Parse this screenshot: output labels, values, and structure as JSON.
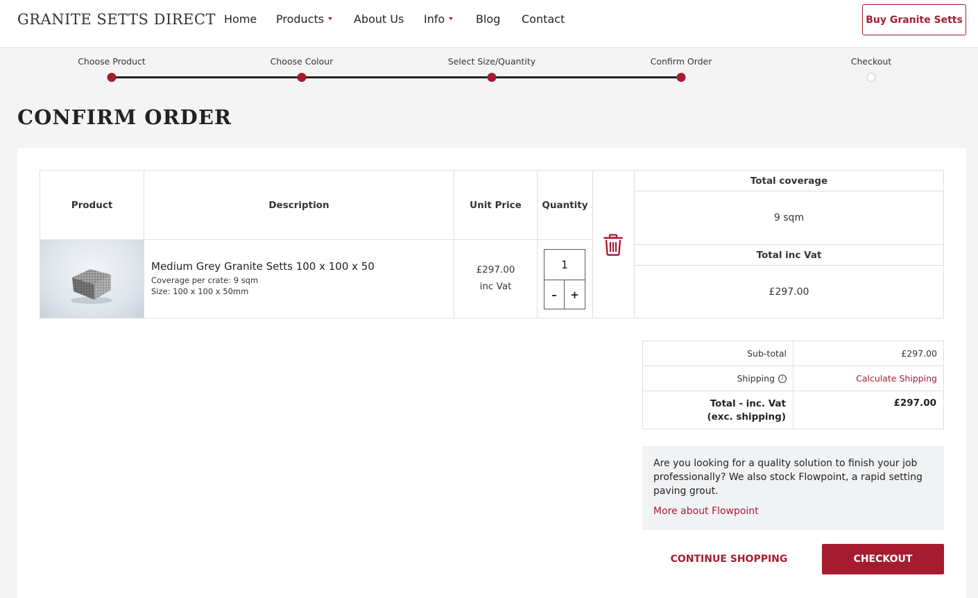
{
  "brand": {
    "logo_text": "GRANITE SETTS DIRECT",
    "accent": "#a51c30"
  },
  "nav": {
    "items": [
      {
        "label": "Home",
        "dropdown": false
      },
      {
        "label": "Products",
        "dropdown": true
      },
      {
        "label": "About Us",
        "dropdown": false
      },
      {
        "label": "Info",
        "dropdown": true
      },
      {
        "label": "Blog",
        "dropdown": false
      },
      {
        "label": "Contact",
        "dropdown": false
      }
    ],
    "cta_label": "Buy Granite Setts"
  },
  "progress": {
    "steps": [
      {
        "label": "Choose Product",
        "done": true
      },
      {
        "label": "Choose Colour",
        "done": true
      },
      {
        "label": "Select Size/Quantity",
        "done": true
      },
      {
        "label": "Confirm Order",
        "done": true
      },
      {
        "label": "Checkout",
        "done": false
      }
    ]
  },
  "page": {
    "title": "CONFIRM ORDER"
  },
  "order_table": {
    "headers": {
      "product": "Product",
      "description": "Description",
      "unit_price": "Unit Price",
      "quantity": "Quantity"
    },
    "row": {
      "name": "Medium Grey Granite Setts 100 x 100 x 50",
      "coverage": "Coverage per crate: 9 sqm",
      "size": "Size: 100 x 100 x 50mm",
      "price": "£297.00",
      "price_note": "inc Vat",
      "quantity": "1",
      "minus": "–",
      "plus": "+",
      "image_icon": "granite-sett-image",
      "delete_icon": "trash-icon"
    },
    "summary": {
      "coverage_label": "Total coverage",
      "coverage_value": "9 sqm",
      "total_label": "Total inc Vat",
      "total_value": "£297.00"
    }
  },
  "totals": {
    "subtotal_label": "Sub-total",
    "subtotal_value": "£297.00",
    "shipping_label": "Shipping",
    "shipping_info_icon": "info-icon",
    "shipping_link": "Calculate Shipping",
    "total_label_line1": "Total - inc. Vat",
    "total_label_line2": "(exc. shipping)",
    "total_value": "£297.00"
  },
  "promo": {
    "text": "Are you looking for a quality solution to finish your job professionally? We also stock Flowpoint, a rapid setting paving grout.",
    "link": "More about Flowpoint"
  },
  "actions": {
    "continue_label": "CONTINUE SHOPPING",
    "checkout_label": "CHECKOUT"
  }
}
